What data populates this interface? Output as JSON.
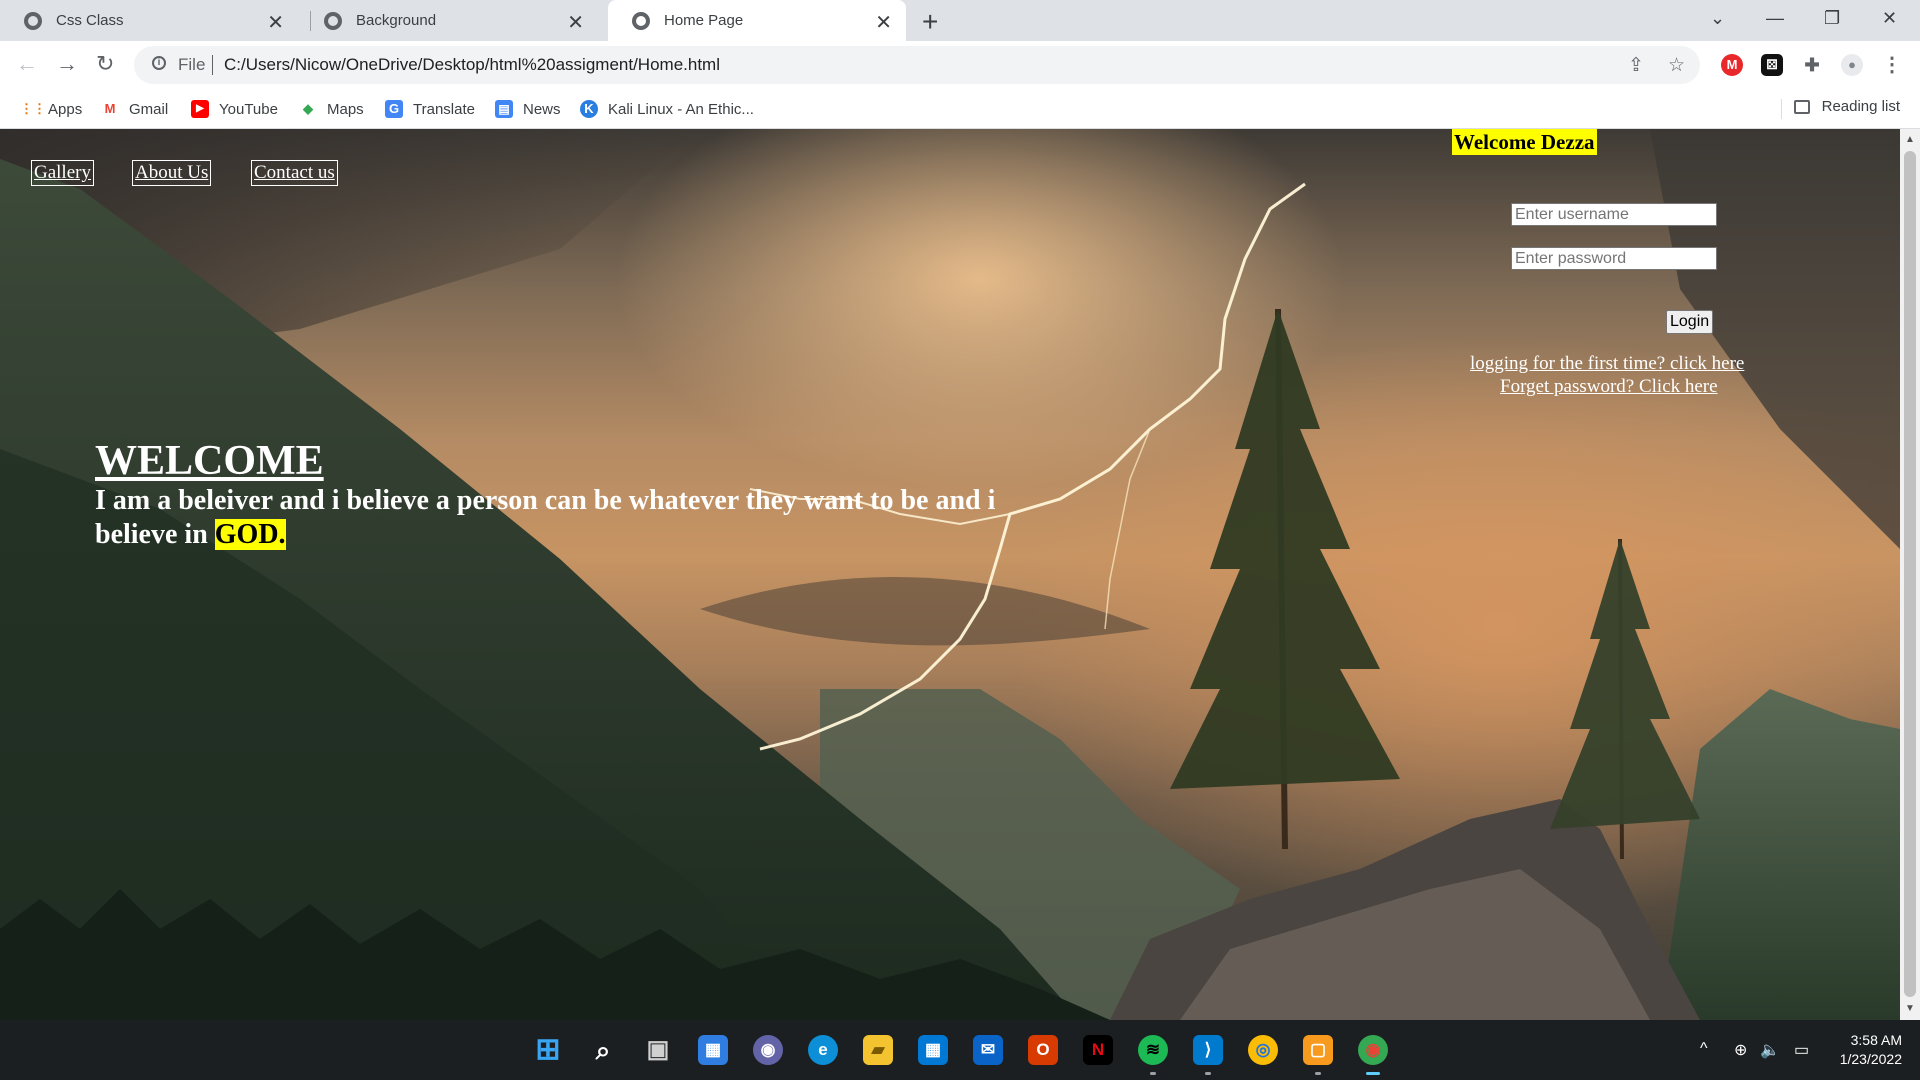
{
  "browser": {
    "tabs": [
      {
        "title": "Css Class",
        "close": "✕"
      },
      {
        "title": "Background",
        "close": "✕"
      },
      {
        "title": "Home Page",
        "close": "✕"
      }
    ],
    "new_tab": "+",
    "window_controls": {
      "collapse": "⌄",
      "minimize": "—",
      "restore": "❐",
      "close": "✕"
    },
    "nav": {
      "back": "←",
      "forward": "→",
      "reload": "↻"
    },
    "address": {
      "scheme": "File",
      "url": "C:/Users/Nicow/OneDrive/Desktop/html%20assigment/Home.html",
      "info": "i"
    },
    "omnibox_icons": {
      "share": "⇪",
      "star": "☆"
    },
    "extensions": [
      {
        "label": "M",
        "icon": "mcafee-icon",
        "color": "#e8282b"
      },
      {
        "label": "⚄",
        "icon": "dice-extension-icon",
        "color": "#111111"
      },
      {
        "label": "✚",
        "icon": "puzzle-icon",
        "color": "#5f6368"
      },
      {
        "label": "●",
        "icon": "profile-icon",
        "color": "#9aa0a6"
      },
      {
        "label": "⋮",
        "icon": "menu-icon",
        "color": "#ffffff"
      }
    ],
    "bookmarks": [
      {
        "label": "Apps",
        "icon": "apps-grid-icon",
        "glyph": "⋮⋮",
        "color": "#e8710a"
      },
      {
        "label": "Gmail",
        "icon": "gmail-icon",
        "glyph": "M",
        "color": "#ea4335"
      },
      {
        "label": "YouTube",
        "icon": "youtube-icon",
        "glyph": "▶",
        "color": "#ff0000"
      },
      {
        "label": "Maps",
        "icon": "maps-icon",
        "glyph": "◆",
        "color": "#34a853"
      },
      {
        "label": "Translate",
        "icon": "translate-icon",
        "glyph": "G",
        "color": "#4285f4"
      },
      {
        "label": "News",
        "icon": "news-icon",
        "glyph": "▤",
        "color": "#4285f4"
      },
      {
        "label": "Kali Linux - An Ethic...",
        "icon": "kali-icon",
        "glyph": "K",
        "color": "#2a7de1"
      }
    ],
    "reading_list": "Reading list"
  },
  "page": {
    "nav_links": [
      "Gallery",
      "About Us",
      "Contact us"
    ],
    "welcome_user": "Welcome Dezza",
    "login": {
      "username_placeholder": "Enter username",
      "password_placeholder": "Enter password",
      "button": "Login",
      "first_time_link": "logging for the first time? click here",
      "forgot_link": "Forget password? Click here"
    },
    "hero": {
      "title": "WELCOME",
      "text_before": "I am a beleiver and i believe a person can be whatever they want to be and i believe in ",
      "highlight": "GOD."
    }
  },
  "taskbar": {
    "apps": [
      {
        "icon": "windows-start-icon",
        "glyph": "⊞",
        "color": "#1a9bf0"
      },
      {
        "icon": "search-icon",
        "glyph": "⌕",
        "color": "transparent"
      },
      {
        "icon": "task-view-icon",
        "glyph": "▣",
        "color": "transparent"
      },
      {
        "icon": "widgets-icon",
        "glyph": "▦",
        "color": "#2f7de1"
      },
      {
        "icon": "teams-chat-icon",
        "glyph": "◉",
        "color": "#6264a7"
      },
      {
        "icon": "edge-icon",
        "glyph": "e",
        "color": "#0c8fd6"
      },
      {
        "icon": "file-explorer-icon",
        "glyph": "▰",
        "color": "#f4c430"
      },
      {
        "icon": "microsoft-store-icon",
        "glyph": "▦",
        "color": "#0078d4"
      },
      {
        "icon": "mail-icon",
        "glyph": "✉",
        "color": "#0a64c8"
      },
      {
        "icon": "office-icon",
        "glyph": "O",
        "color": "#d83b01"
      },
      {
        "icon": "netflix-icon",
        "glyph": "N",
        "color": "#000000"
      },
      {
        "icon": "spotify-icon",
        "glyph": "≋",
        "color": "#1db954"
      },
      {
        "icon": "vscode-icon",
        "glyph": "⟩",
        "color": "#007acc"
      },
      {
        "icon": "chrome-alt-icon",
        "glyph": "◎",
        "color": "#fbbc05"
      },
      {
        "icon": "remote-desktop-icon",
        "glyph": "▢",
        "color": "#f79a1d"
      },
      {
        "icon": "chrome-icon",
        "glyph": "◉",
        "color": "#34a853"
      }
    ],
    "tray": {
      "chevron": "^",
      "language": "⊕",
      "volume": "🔈",
      "battery": "▭"
    },
    "time": "3:58 AM",
    "date": "1/23/2022"
  }
}
